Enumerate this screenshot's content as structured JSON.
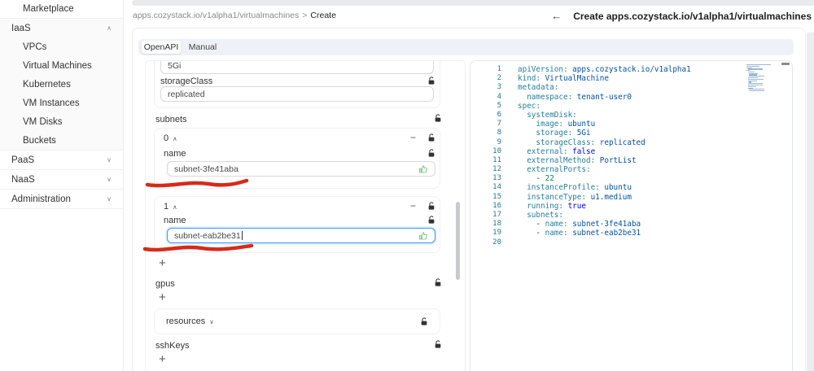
{
  "colors": {
    "focus_blue": "#4096ff",
    "annotation_red": "#d62b1a",
    "thumb_green": "#6abe71",
    "yaml_key": "#267f99",
    "yaml_string": "#0451a5",
    "yaml_keyword": "#0000ff",
    "yaml_number": "#098658",
    "tabstrip_bg": "#eef1f7"
  },
  "sidebar": {
    "items": [
      {
        "label": "Marketplace"
      },
      {
        "label": "IaaS",
        "chevron": "∧"
      },
      {
        "label": "VPCs"
      },
      {
        "label": "Virtual Machines"
      },
      {
        "label": "Kubernetes"
      },
      {
        "label": "VM Instances"
      },
      {
        "label": "VM Disks"
      },
      {
        "label": "Buckets"
      },
      {
        "label": "PaaS",
        "chevron": "∨"
      },
      {
        "label": "NaaS",
        "chevron": "∨"
      },
      {
        "label": "Administration",
        "chevron": "∨"
      }
    ]
  },
  "breadcrumb": {
    "path": "apps.cozystack.io/v1alpha1/virtualmachines",
    "separator": ">",
    "current": "Create"
  },
  "header": {
    "back_icon": "←",
    "title": "Create apps.cozystack.io/v1alpha1/virtualmachines"
  },
  "tabs": [
    {
      "label": "OpenAPI",
      "active": true
    },
    {
      "label": "Manual",
      "active": false
    }
  ],
  "form": {
    "top_input_value": "5Gi",
    "storage_class": {
      "label": "storageClass",
      "value": "replicated"
    },
    "subnets": {
      "label": "subnets",
      "collapse_icon": "∧",
      "remove_icon": "−",
      "add_icon": "+",
      "items": [
        {
          "index": "0",
          "field_label": "name",
          "value": "subnet-3fe41aba"
        },
        {
          "index": "1",
          "field_label": "name",
          "value": "subnet-eab2be31"
        }
      ]
    },
    "gpus": {
      "label": "gpus",
      "add_icon": "+"
    },
    "resources": {
      "label": "resources",
      "collapse_icon": "∨"
    },
    "ssh_keys": {
      "label": "sshKeys",
      "add_icon": "+"
    }
  },
  "editor": {
    "lines": [
      {
        "num": "1",
        "tokens": [
          {
            "c": "k",
            "t": "apiVersion:"
          },
          {
            "c": "s",
            "t": " apps.cozystack.io/v1alpha1"
          }
        ]
      },
      {
        "num": "2",
        "tokens": [
          {
            "c": "k",
            "t": "kind:"
          },
          {
            "c": "s",
            "t": " VirtualMachine"
          }
        ]
      },
      {
        "num": "3",
        "tokens": [
          {
            "c": "k",
            "t": "metadata:"
          }
        ]
      },
      {
        "num": "4",
        "tokens": [
          {
            "c": "p",
            "t": "  "
          },
          {
            "c": "k",
            "t": "namespace:"
          },
          {
            "c": "s",
            "t": " tenant-user0"
          }
        ]
      },
      {
        "num": "5",
        "tokens": [
          {
            "c": "k",
            "t": "spec:"
          }
        ]
      },
      {
        "num": "6",
        "tokens": [
          {
            "c": "p",
            "t": "  "
          },
          {
            "c": "k",
            "t": "systemDisk:"
          }
        ]
      },
      {
        "num": "7",
        "tokens": [
          {
            "c": "p",
            "t": "    "
          },
          {
            "c": "k",
            "t": "image:"
          },
          {
            "c": "s",
            "t": " ubuntu"
          }
        ]
      },
      {
        "num": "8",
        "tokens": [
          {
            "c": "p",
            "t": "    "
          },
          {
            "c": "k",
            "t": "storage:"
          },
          {
            "c": "s",
            "t": " 5Gi"
          }
        ]
      },
      {
        "num": "9",
        "tokens": [
          {
            "c": "p",
            "t": "    "
          },
          {
            "c": "k",
            "t": "storageClass:"
          },
          {
            "c": "s",
            "t": " replicated"
          }
        ]
      },
      {
        "num": "10",
        "tokens": [
          {
            "c": "p",
            "t": "  "
          },
          {
            "c": "k",
            "t": "external:"
          },
          {
            "c": "b",
            "t": " false"
          }
        ]
      },
      {
        "num": "11",
        "tokens": [
          {
            "c": "p",
            "t": "  "
          },
          {
            "c": "k",
            "t": "externalMethod:"
          },
          {
            "c": "s",
            "t": " PortList"
          }
        ]
      },
      {
        "num": "12",
        "tokens": [
          {
            "c": "p",
            "t": "  "
          },
          {
            "c": "k",
            "t": "externalPorts:"
          }
        ]
      },
      {
        "num": "13",
        "tokens": [
          {
            "c": "p",
            "t": "    - "
          },
          {
            "c": "n",
            "t": "22"
          }
        ]
      },
      {
        "num": "14",
        "tokens": [
          {
            "c": "p",
            "t": "  "
          },
          {
            "c": "k",
            "t": "instanceProfile:"
          },
          {
            "c": "s",
            "t": " ubuntu"
          }
        ]
      },
      {
        "num": "15",
        "tokens": [
          {
            "c": "p",
            "t": "  "
          },
          {
            "c": "k",
            "t": "instanceType:"
          },
          {
            "c": "s",
            "t": " u1.medium"
          }
        ]
      },
      {
        "num": "16",
        "tokens": [
          {
            "c": "p",
            "t": "  "
          },
          {
            "c": "k",
            "t": "running:"
          },
          {
            "c": "b",
            "t": " true"
          }
        ]
      },
      {
        "num": "17",
        "tokens": [
          {
            "c": "p",
            "t": "  "
          },
          {
            "c": "k",
            "t": "subnets:"
          }
        ]
      },
      {
        "num": "18",
        "tokens": [
          {
            "c": "p",
            "t": "    - "
          },
          {
            "c": "k",
            "t": "name:"
          },
          {
            "c": "s",
            "t": " subnet-3fe41aba"
          }
        ]
      },
      {
        "num": "19",
        "tokens": [
          {
            "c": "p",
            "t": "    - "
          },
          {
            "c": "k",
            "t": "name:"
          },
          {
            "c": "s",
            "t": " subnet-eab2be31"
          }
        ]
      },
      {
        "num": "20",
        "tokens": []
      }
    ]
  }
}
